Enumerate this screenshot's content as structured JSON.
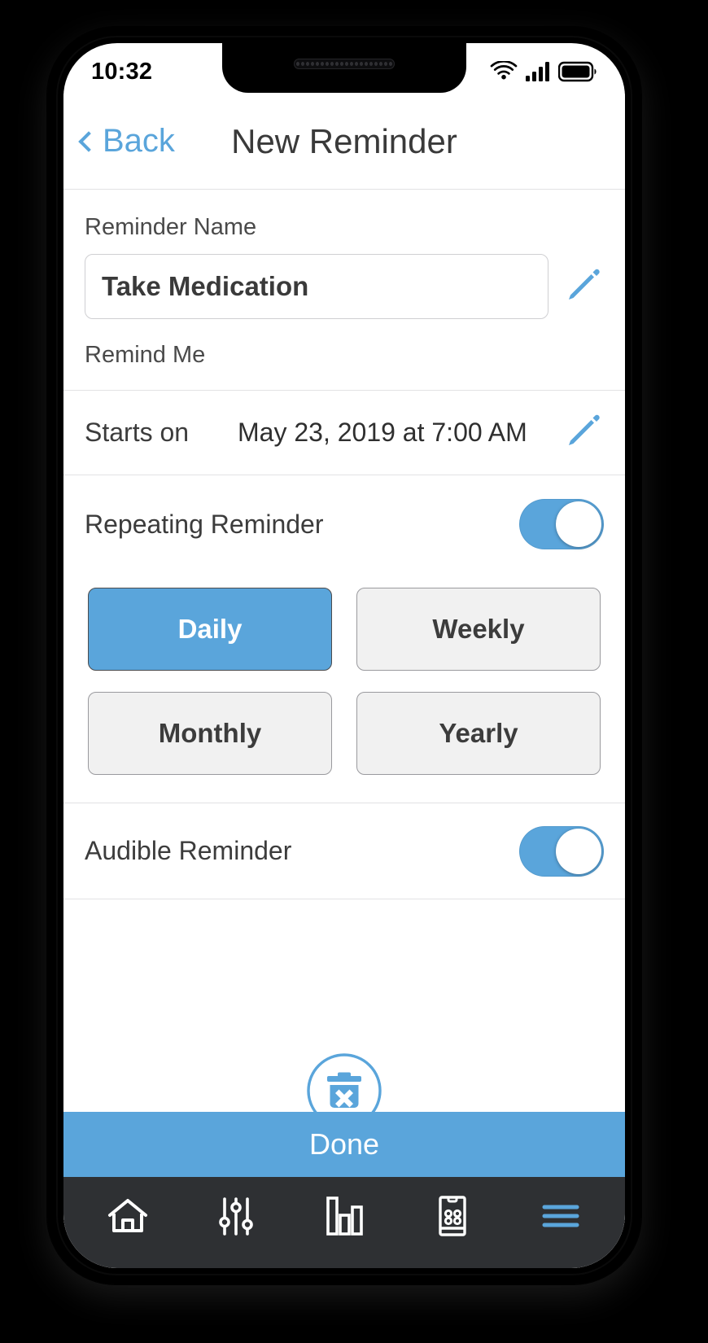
{
  "status_bar": {
    "time": "10:32",
    "icons": [
      "wifi-icon",
      "cellular-signal-icon",
      "battery-icon"
    ]
  },
  "nav": {
    "back_label": "Back",
    "title": "New Reminder",
    "back_icon": "chevron-left-icon"
  },
  "form": {
    "name_label": "Reminder Name",
    "name_value": "Take Medication",
    "name_placeholder": "Reminder Name",
    "name_edit_icon": "pencil-icon",
    "remind_me_label": "Remind Me",
    "starts_on_label": "Starts on",
    "starts_on_value": "May 23, 2019 at  7:00 AM",
    "starts_on_edit_icon": "pencil-icon",
    "repeating_label": "Repeating Reminder",
    "repeating_on": true,
    "frequencies": [
      {
        "label": "Daily",
        "selected": true
      },
      {
        "label": "Weekly",
        "selected": false
      },
      {
        "label": "Monthly",
        "selected": false
      },
      {
        "label": "Yearly",
        "selected": false
      }
    ],
    "audible_label": "Audible Reminder",
    "audible_on": true,
    "delete_icon": "trash-delete-icon"
  },
  "footer": {
    "done_label": "Done"
  },
  "tabbar": {
    "items": [
      {
        "icon": "home-icon",
        "active": false
      },
      {
        "icon": "sliders-icon",
        "active": false
      },
      {
        "icon": "bar-chart-icon",
        "active": false
      },
      {
        "icon": "remote-device-icon",
        "active": false
      },
      {
        "icon": "hamburger-menu-icon",
        "active": true
      }
    ]
  },
  "colors": {
    "accent": "#5aa5db",
    "tabbar_bg": "#2e3033",
    "text": "#3a3a3a",
    "divider": "#e2e2e4"
  }
}
